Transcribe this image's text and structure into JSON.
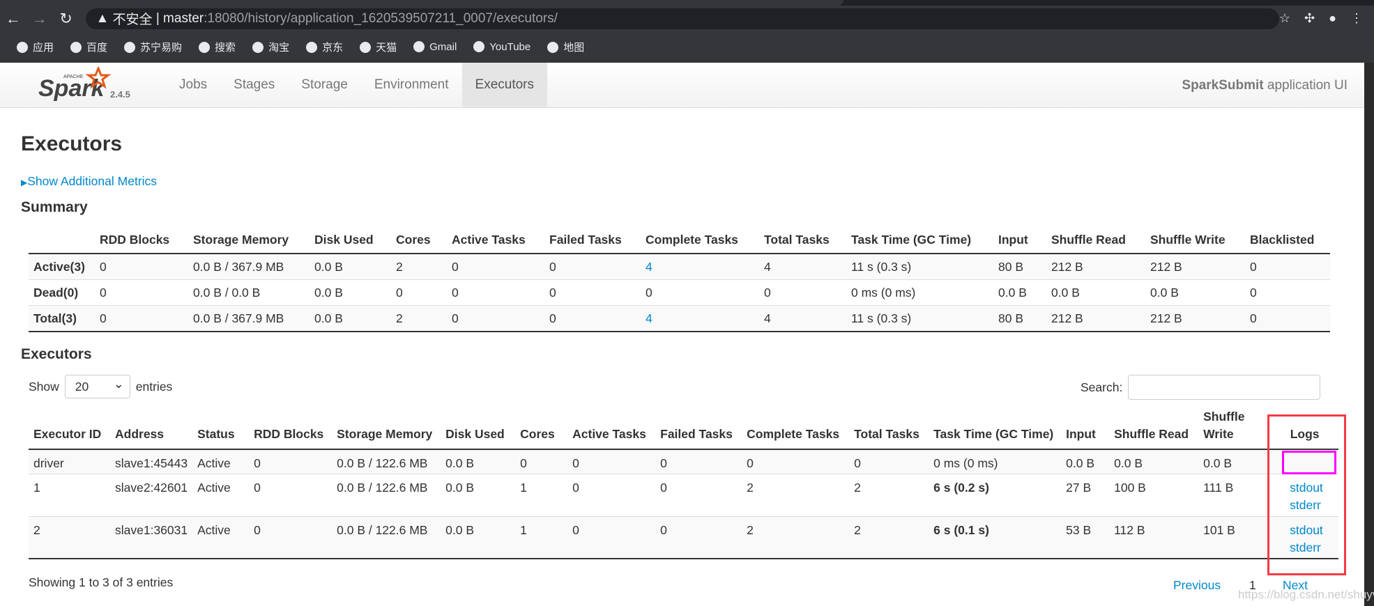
{
  "browser": {
    "insecure": "不安全",
    "url_host": "master",
    "url_rest": ":18080/history/application_1620539507211_0007/executors/",
    "bookmarks": [
      "应用",
      "百度",
      "苏宁易购",
      "搜索",
      "淘宝",
      "京东",
      "天猫",
      "Gmail",
      "YouTube",
      "地图"
    ]
  },
  "navbar": {
    "logo": "Apache Spark",
    "version": "2.4.5",
    "links": [
      "Jobs",
      "Stages",
      "Storage",
      "Environment",
      "Executors"
    ],
    "active": "Executors",
    "app_name": "SparkSubmit",
    "app_suffix": " application UI"
  },
  "page_title": "Executors",
  "show_metrics": "Show Additional Metrics",
  "summary": {
    "title": "Summary",
    "headers": [
      "",
      "RDD Blocks",
      "Storage Memory",
      "Disk Used",
      "Cores",
      "Active Tasks",
      "Failed Tasks",
      "Complete Tasks",
      "Total Tasks",
      "Task Time (GC Time)",
      "Input",
      "Shuffle Read",
      "Shuffle Write",
      "Blacklisted"
    ],
    "rows": [
      [
        "Active(3)",
        "0",
        "0.0 B / 367.9 MB",
        "0.0 B",
        "2",
        "0",
        "0",
        "4",
        "4",
        "11 s (0.3 s)",
        "80 B",
        "212 B",
        "212 B",
        "0"
      ],
      [
        "Dead(0)",
        "0",
        "0.0 B / 0.0 B",
        "0.0 B",
        "0",
        "0",
        "0",
        "0",
        "0",
        "0 ms (0 ms)",
        "0.0 B",
        "0.0 B",
        "0.0 B",
        "0"
      ],
      [
        "Total(3)",
        "0",
        "0.0 B / 367.9 MB",
        "0.0 B",
        "2",
        "0",
        "0",
        "4",
        "4",
        "11 s (0.3 s)",
        "80 B",
        "212 B",
        "212 B",
        "0"
      ]
    ]
  },
  "executors": {
    "title": "Executors",
    "show": "Show",
    "entries_value": "20",
    "entries": "entries",
    "search_label": "Search:",
    "headers": [
      "Executor ID",
      "Address",
      "Status",
      "RDD Blocks",
      "Storage Memory",
      "Disk Used",
      "Cores",
      "Active Tasks",
      "Failed Tasks",
      "Complete Tasks",
      "Total Tasks",
      "Task Time (GC Time)",
      "Input",
      "Shuffle Read",
      "Shuffle Write",
      "Logs"
    ],
    "rows": [
      [
        "driver",
        "slave1:45443",
        "Active",
        "0",
        "0.0 B / 122.6 MB",
        "0.0 B",
        "0",
        "0",
        "0",
        "0",
        "0",
        "0 ms (0 ms)",
        "0.0 B",
        "0.0 B",
        "0.0 B"
      ],
      [
        "1",
        "slave2:42601",
        "Active",
        "0",
        "0.0 B / 122.6 MB",
        "0.0 B",
        "1",
        "0",
        "0",
        "2",
        "2",
        "6 s (0.2 s)",
        "27 B",
        "100 B",
        "111 B"
      ],
      [
        "2",
        "slave1:36031",
        "Active",
        "0",
        "0.0 B / 122.6 MB",
        "0.0 B",
        "1",
        "0",
        "0",
        "2",
        "2",
        "6 s (0.1 s)",
        "53 B",
        "112 B",
        "101 B"
      ]
    ],
    "logs": {
      "stdout": "stdout",
      "stderr": "stderr"
    },
    "info": "Showing 1 to 3 of 3 entries",
    "previous": "Previous",
    "page": "1",
    "next": "Next"
  },
  "watermark": "https://blog.csdn.net/shuyv",
  "colors": {
    "link": "#0088cc",
    "highlight_red": "#f43a45",
    "highlight_magenta": "#ff00ff"
  }
}
